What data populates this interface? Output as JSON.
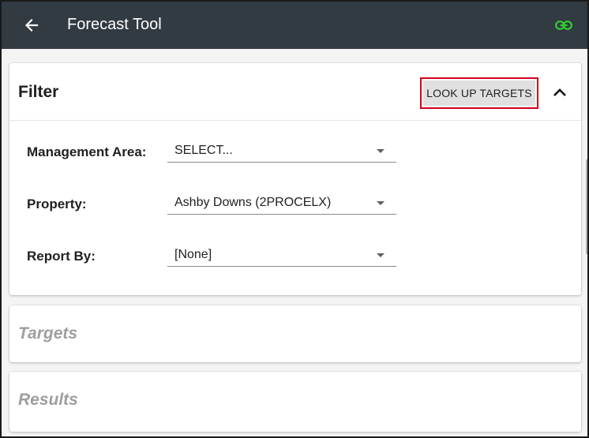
{
  "app_bar": {
    "title": "Forecast Tool",
    "back_icon": "arrow-left-icon",
    "link_icon": "link-icon",
    "link_icon_color": "#2fd12f",
    "background_color": "#323a42"
  },
  "filter": {
    "title": "Filter",
    "lookup_button_label": "LOOK UP TARGETS",
    "lookup_highlight_color": "#d0021b",
    "collapse_icon": "chevron-up-icon",
    "fields": {
      "management_area": {
        "label": "Management Area:",
        "value": "SELECT..."
      },
      "property": {
        "label": "Property:",
        "value": "Ashby Downs (2PROCELX)"
      },
      "report_by": {
        "label": "Report By:",
        "value": "[None]"
      }
    }
  },
  "targets": {
    "title": "Targets"
  },
  "results": {
    "title": "Results"
  }
}
